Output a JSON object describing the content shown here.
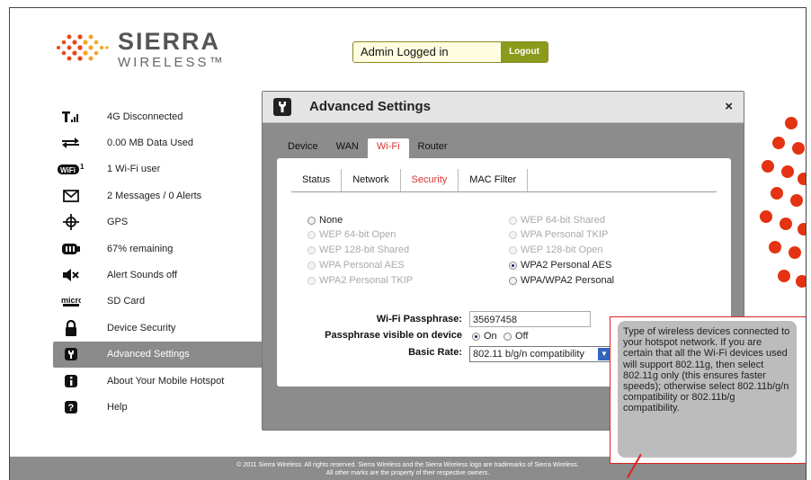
{
  "brand": {
    "name": "SIERRA",
    "sub": "WIRELESS™"
  },
  "header": {
    "admin_text": "Admin Logged in",
    "logout_label": "Logout"
  },
  "sidebar": {
    "items": [
      {
        "icon": "signal-icon",
        "label": "4G Disconnected"
      },
      {
        "icon": "data-transfer-icon",
        "label": "0.00 MB Data Used"
      },
      {
        "icon": "wifi-icon",
        "badge": "1",
        "label": "1 Wi-Fi user"
      },
      {
        "icon": "envelope-icon",
        "label": "2 Messages / 0 Alerts"
      },
      {
        "icon": "gps-icon",
        "label": "GPS"
      },
      {
        "icon": "battery-icon",
        "label": "67% remaining"
      },
      {
        "icon": "speaker-muted-icon",
        "label": "Alert Sounds off"
      },
      {
        "icon": "microsd-icon",
        "label": "SD Card"
      },
      {
        "icon": "lock-icon",
        "label": "Device Security"
      },
      {
        "icon": "wrench-icon",
        "label": "Advanced Settings",
        "active": true
      },
      {
        "icon": "info-icon",
        "label": "About Your Mobile Hotspot"
      },
      {
        "icon": "help-icon",
        "label": "Help"
      }
    ]
  },
  "dialog": {
    "title": "Advanced Settings",
    "close": "×",
    "tabs": [
      "Device",
      "WAN",
      "Wi-Fi",
      "Router"
    ],
    "active_tab": "Wi-Fi",
    "sub_tabs": [
      "Status",
      "Network",
      "Security",
      "MAC Filter"
    ],
    "active_sub_tab": "Security",
    "security_left": [
      {
        "label": "None",
        "enabled": true,
        "checked": false
      },
      {
        "label": "WEP 64-bit Open",
        "enabled": false,
        "checked": false
      },
      {
        "label": "WEP 128-bit Shared",
        "enabled": false,
        "checked": false
      },
      {
        "label": "WPA Personal AES",
        "enabled": false,
        "checked": false
      },
      {
        "label": "WPA2 Personal TKIP",
        "enabled": false,
        "checked": false
      }
    ],
    "security_right": [
      {
        "label": "WEP 64-bit Shared",
        "enabled": false,
        "checked": false
      },
      {
        "label": "WPA Personal TKIP",
        "enabled": false,
        "checked": false
      },
      {
        "label": "WEP 128-bit Open",
        "enabled": false,
        "checked": false
      },
      {
        "label": "WPA2 Personal AES",
        "enabled": true,
        "checked": true
      },
      {
        "label": "WPA/WPA2 Personal",
        "enabled": true,
        "checked": false
      }
    ],
    "passphrase_label": "Wi-Fi Passphrase:",
    "passphrase_value": "35697458",
    "visible_label": "Passphrase visible on device",
    "visible_on": "On",
    "visible_off": "Off",
    "visible_selected": "On",
    "basic_rate_label": "Basic Rate:",
    "basic_rate_value": "802.11 b/g/n compatibility"
  },
  "tooltip": {
    "text": "Type of wireless devices connected to your hotspot network. If you are certain that all the Wi-Fi devices used will support 802.11g, then select 802.11g only (this ensures faster speeds); otherwise select 802.11b/g/n compatibility or 802.11b/g compatibility."
  },
  "footer": {
    "line1": "© 2011 Sierra Wireless. All rights reserved. Sierra Wireless and the Sierra Wireless logo are trademarks of Sierra Wireless.",
    "line2": "All other marks are the property of their respective owners."
  },
  "colors": {
    "accent_red": "#dd3333",
    "logout_green": "#8a9a1a",
    "panel_gray": "#8c8c8c"
  }
}
